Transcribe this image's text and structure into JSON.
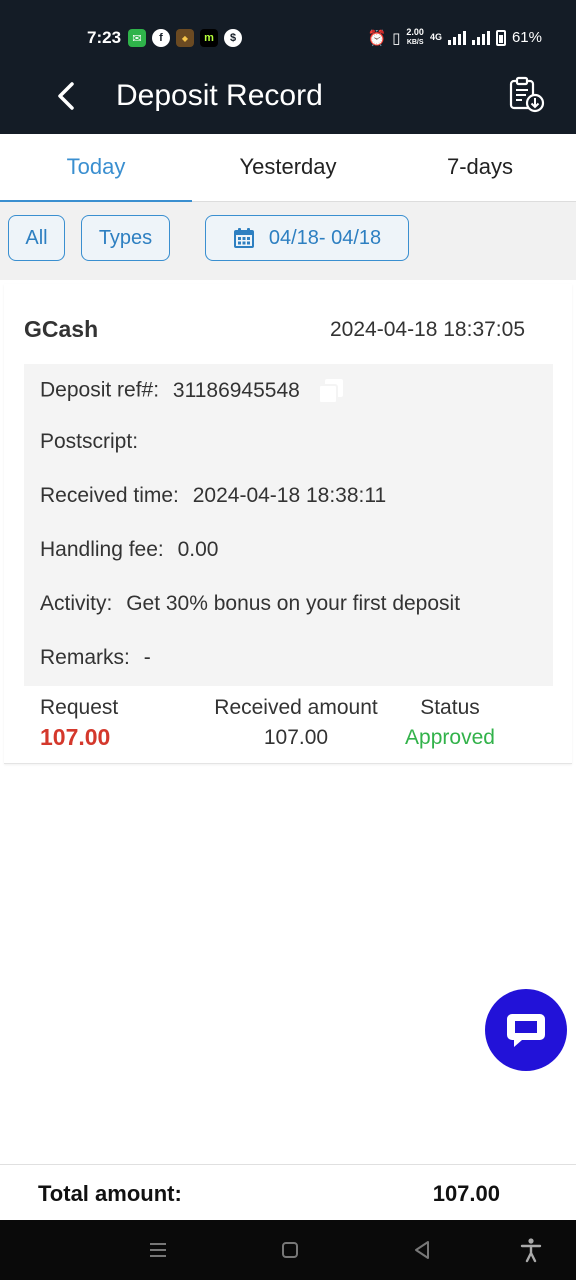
{
  "status_bar": {
    "time": "7:23",
    "net_speed_value": "2.00",
    "net_speed_unit": "KB/S",
    "network_type": "4G",
    "battery": "61%"
  },
  "header": {
    "title": "Deposit Record"
  },
  "tabs": [
    {
      "label": "Today",
      "active": true
    },
    {
      "label": "Yesterday",
      "active": false
    },
    {
      "label": "7-days",
      "active": false
    }
  ],
  "filters": {
    "all_label": "All",
    "types_label": "Types",
    "date_range": "04/18- 04/18"
  },
  "record": {
    "method": "GCash",
    "datetime": "2024-04-18 18:37:05",
    "details": {
      "deposit_ref_label": "Deposit ref#:",
      "deposit_ref_value": "31186945548",
      "postscript_label": "Postscript:",
      "postscript_value": "",
      "received_time_label": "Received time:",
      "received_time_value": "2024-04-18 18:38:11",
      "handling_fee_label": "Handling fee:",
      "handling_fee_value": "0.00",
      "activity_label": "Activity:",
      "activity_value": "Get 30% bonus on your first deposit",
      "remarks_label": "Remarks:",
      "remarks_value": "-"
    },
    "summary": {
      "request_label": "Request",
      "request_value": "107.00",
      "received_label": "Received amount",
      "received_value": "107.00",
      "status_label": "Status",
      "status_value": "Approved"
    }
  },
  "total": {
    "label": "Total amount:",
    "value": "107.00"
  },
  "colors": {
    "header_bg": "#141c26",
    "accent": "#3a8fd0",
    "request_red": "#d4382c",
    "status_green": "#32b24a",
    "chat_fab": "#2212d8"
  },
  "icons": [
    "back-arrow-icon",
    "export-record-icon",
    "calendar-icon",
    "copy-icon",
    "chat-icon",
    "menu-icon",
    "home-icon",
    "back-nav-icon",
    "accessibility-icon"
  ]
}
